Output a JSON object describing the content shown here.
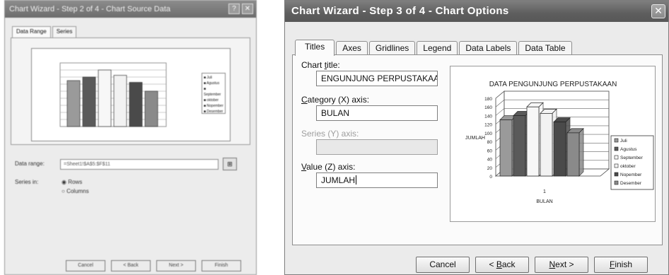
{
  "left_dialog": {
    "title": "Chart Wizard - Step 2 of 4 - Chart Source Data",
    "tabs": [
      "Data Range",
      "Series"
    ],
    "data_range_label": "Data range:",
    "data_range_value": "=Sheet1!$A$5:$F$11",
    "series_in_label": "Series in:",
    "radio_rows": "Rows",
    "radio_columns": "Columns",
    "legend": [
      "Juli",
      "Agustus",
      "September",
      "oktober",
      "Nopember",
      "Desember"
    ],
    "buttons": [
      "Cancel",
      "< Back",
      "Next >",
      "Finish"
    ]
  },
  "dialog": {
    "title": "Chart Wizard - Step 3 of 4 - Chart Options",
    "close_glyph": "✕",
    "tabs": [
      {
        "label": "Titles",
        "active": true
      },
      {
        "label": "Axes",
        "active": false
      },
      {
        "label": "Gridlines",
        "active": false
      },
      {
        "label": "Legend",
        "active": false
      },
      {
        "label": "Data Labels",
        "active": false
      },
      {
        "label": "Data Table",
        "active": false
      }
    ],
    "fields": {
      "chart_title": {
        "label_prefix": "Chart ",
        "label_key": "t",
        "label_suffix": "itle:",
        "value": "ENGUNJUNG PERPUSTAKAAN"
      },
      "category_axis": {
        "label_key": "C",
        "label_suffix": "ategory (X) axis:",
        "value": "BULAN"
      },
      "series_axis": {
        "label": "Series (Y) axis:",
        "value": "",
        "disabled": true
      },
      "value_axis": {
        "label_key": "V",
        "label_suffix": "alue (Z) axis:",
        "value": "JUMLAH"
      }
    },
    "buttons": {
      "cancel": "Cancel",
      "back_prefix": "< ",
      "back_key": "B",
      "back_suffix": "ack",
      "next_key": "N",
      "next_suffix": "ext >",
      "finish_key": "F",
      "finish_suffix": "inish"
    }
  },
  "chart_data": {
    "type": "bar",
    "title": "DATA PENGUNJUNG PERPUSTAKAAN",
    "xlabel": "BULAN",
    "ylabel": "JUMLAH",
    "categories": [
      "1"
    ],
    "series": [
      {
        "name": "Juli",
        "values": [
          130
        ],
        "color": "#9a9a9a"
      },
      {
        "name": "Agustus",
        "values": [
          140
        ],
        "color": "#5a5a5a"
      },
      {
        "name": "September",
        "values": [
          160
        ],
        "color": "#f7f7f7"
      },
      {
        "name": "oktober",
        "values": [
          145
        ],
        "color": "#f2f2f2"
      },
      {
        "name": "Nopember",
        "values": [
          125
        ],
        "color": "#4a4a4a"
      },
      {
        "name": "Desember",
        "values": [
          100
        ],
        "color": "#8a8a8a"
      }
    ],
    "ylim": [
      0,
      180
    ],
    "yticks": [
      0,
      20,
      40,
      60,
      80,
      100,
      120,
      140,
      160,
      180
    ],
    "grid": true,
    "legend_position": "right"
  }
}
